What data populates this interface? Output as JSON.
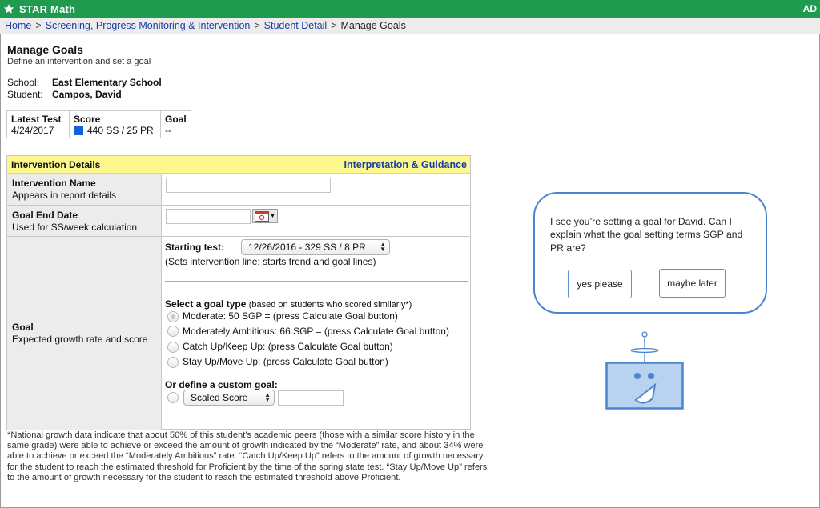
{
  "app": {
    "name": "STAR Math",
    "user_initials": "AD"
  },
  "breadcrumb": [
    {
      "label": "Home",
      "link": true
    },
    {
      "label": "Screening, Progress Monitoring & Intervention",
      "link": true
    },
    {
      "label": "Student Detail",
      "link": true
    },
    {
      "label": "Manage Goals",
      "link": false
    }
  ],
  "page": {
    "title": "Manage Goals",
    "subtitle": "Define an intervention and set a goal"
  },
  "student": {
    "school_label": "School:",
    "school": "East Elementary School",
    "student_label": "Student:",
    "name": "Campos, David"
  },
  "score_table": {
    "headers": [
      "Latest Test",
      "Score",
      "Goal"
    ],
    "latest_test": "4/24/2017",
    "score": "440 SS / 25 PR",
    "goal": "--",
    "score_color": "#1460d8"
  },
  "form": {
    "header": "Intervention Details",
    "guidance_link": "Interpretation & Guidance",
    "intervention_name": {
      "label": "Intervention Name",
      "sub": "Appears in report details",
      "value": ""
    },
    "goal_end_date": {
      "label": "Goal End Date",
      "sub": "Used for SS/week calculation",
      "value": ""
    },
    "goal": {
      "label": "Goal",
      "sub": "Expected growth rate and score",
      "starting_test_label": "Starting test:",
      "starting_test_value": "12/26/2016 - 329 SS / 8 PR",
      "starting_test_note": "(Sets intervention line; starts trend and goal lines)",
      "goal_type_label": "Select a goal type",
      "goal_type_note": "(based on students who scored similarly*)",
      "options": [
        "Moderate: 50 SGP = (press Calculate Goal button)",
        "Moderately Ambitious: 66 SGP = (press Calculate Goal button)",
        "Catch Up/Keep Up: (press Calculate Goal button)",
        "Stay Up/Move Up: (press Calculate Goal button)"
      ],
      "selected_option": 0,
      "custom_label": "Or define a custom goal:",
      "custom_select": "Scaled Score",
      "custom_value": ""
    }
  },
  "footnote": "*National growth data indicate that about 50% of this student’s academic peers (those with a similar score history in the same grade) were able to achieve or exceed the amount of growth indicated by the “Moderate” rate, and about 34% were able to achieve or exceed the “Moderately Ambitious” rate. “Catch Up/Keep Up” refers to the amount of growth necessary for the student to reach the estimated threshold for Proficient by the time of the spring state test. “Stay Up/Move Up” refers to the amount of growth necessary for the student to reach the estimated threshold above Proficient.",
  "assistant": {
    "message": "I see you’re setting a goal for David. Can I explain what the goal setting terms SGP and PR are?",
    "yes_label": "yes please",
    "later_label": "maybe later",
    "accent": "#4a86d0",
    "robot_fill": "#b9d2f0"
  }
}
